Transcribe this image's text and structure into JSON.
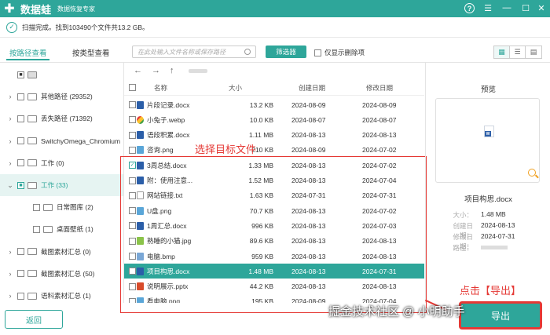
{
  "app": {
    "name": "数据蛙",
    "subtitle": "数据恢复专家",
    "help": "?"
  },
  "status": {
    "text": "扫描完成。找到103490个文件共13.2 GB。"
  },
  "tabs": {
    "by_path": "按路径查看",
    "by_type": "按类型查看"
  },
  "search": {
    "placeholder": "在此处输入文件名称或保存路径"
  },
  "filter_button": "筛选器",
  "deleted_only": "仅显示删除项",
  "tree": [
    {
      "label": "",
      "arrow": "",
      "checked": "■",
      "sel": false
    },
    {
      "label": "其他路径 (29352)",
      "arrow": "›",
      "checked": "",
      "sel": false
    },
    {
      "label": "丢失路径 (71392)",
      "arrow": "›",
      "checked": "",
      "sel": false
    },
    {
      "label": "SwitchyOmega_Chromium",
      "arrow": "›",
      "checked": "",
      "sel": false
    },
    {
      "label": "工作 (0)",
      "arrow": "›",
      "checked": "",
      "sel": false
    },
    {
      "label": "工作 (33)",
      "arrow": "⌄",
      "checked": "■",
      "sel": true
    },
    {
      "label": "日常图库 (2)",
      "arrow": "",
      "checked": "",
      "sel": false
    },
    {
      "label": "桌面壁纸 (1)",
      "arrow": "",
      "checked": "",
      "sel": false
    },
    {
      "label": "截图素材汇总 (0)",
      "arrow": "›",
      "checked": "",
      "sel": false
    },
    {
      "label": "截图素材汇总 (50)",
      "arrow": "›",
      "checked": "",
      "sel": false
    },
    {
      "label": "语料素材汇总 (1)",
      "arrow": "›",
      "checked": "",
      "sel": false
    }
  ],
  "columns": {
    "name": "名称",
    "size": "大小",
    "created": "创建日期",
    "modified": "修改日期"
  },
  "files": [
    {
      "name": "片段记录.docx",
      "size": "13.2 KB",
      "created": "2024-08-09",
      "modified": "2024-08-09",
      "type": "docx",
      "checked": "",
      "hl": false
    },
    {
      "name": "小兔子.webp",
      "size": "10.0 KB",
      "created": "2024-08-07",
      "modified": "2024-08-07",
      "type": "webp",
      "checked": "",
      "hl": false
    },
    {
      "name": "语段积累.docx",
      "size": "1.11 MB",
      "created": "2024-08-13",
      "modified": "2024-08-13",
      "type": "docx",
      "checked": "",
      "hl": false
    },
    {
      "name": "咨询.png",
      "size": "210 KB",
      "created": "2024-08-09",
      "modified": "2024-07-02",
      "type": "png",
      "checked": "",
      "hl": false
    },
    {
      "name": "3周总结.docx",
      "size": "1.33 MB",
      "created": "2024-08-13",
      "modified": "2024-07-02",
      "type": "docx",
      "checked": "✓",
      "hl": false
    },
    {
      "name": "附：使用注意...",
      "size": "1.52 MB",
      "created": "2024-08-13",
      "modified": "2024-07-04",
      "type": "docx",
      "checked": "",
      "hl": false
    },
    {
      "name": "网站链接.txt",
      "size": "1.63 KB",
      "created": "2024-07-31",
      "modified": "2024-07-31",
      "type": "txt",
      "checked": "",
      "hl": false
    },
    {
      "name": "U盘.png",
      "size": "70.7 KB",
      "created": "2024-08-13",
      "modified": "2024-07-02",
      "type": "png",
      "checked": "",
      "hl": false
    },
    {
      "name": "1周汇总.docx",
      "size": "996 KB",
      "created": "2024-08-13",
      "modified": "2024-07-03",
      "type": "docx",
      "checked": "",
      "hl": false
    },
    {
      "name": "熟睡的小猫.jpg",
      "size": "89.6 KB",
      "created": "2024-08-13",
      "modified": "2024-08-13",
      "type": "jpg",
      "checked": "",
      "hl": false
    },
    {
      "name": "电脑.bmp",
      "size": "959 KB",
      "created": "2024-08-13",
      "modified": "2024-08-13",
      "type": "bmp",
      "checked": "",
      "hl": false
    },
    {
      "name": "项目构思.docx",
      "size": "1.48 MB",
      "created": "2024-08-13",
      "modified": "2024-07-31",
      "type": "docx",
      "checked": "",
      "hl": true
    },
    {
      "name": "说明展示.pptx",
      "size": "44.2 KB",
      "created": "2024-08-13",
      "modified": "2024-08-13",
      "type": "pptx",
      "checked": "",
      "hl": false
    },
    {
      "name": "看电脑.png",
      "size": "195 KB",
      "created": "2024-08-09",
      "modified": "2024-07-04",
      "type": "png",
      "checked": "",
      "hl": false
    }
  ],
  "annotation_select": "选择目标文件",
  "annotation_export": "点击【导出】",
  "preview": {
    "title": "预览",
    "icon_text": "W",
    "file_name": "项目构思.docx",
    "size_label": "大小：",
    "size": "1.48 MB",
    "created_label": "创建日期：",
    "created": "2024-08-13",
    "modified_label": "修改日期：",
    "modified": "2024-07-31",
    "path_label": "路径："
  },
  "back_button": "返回",
  "export_button": "导出",
  "watermark": "掘金技术社区 @ 小明助手",
  "colors": {
    "accent": "#2ea69a",
    "annotation": "#e53935"
  }
}
